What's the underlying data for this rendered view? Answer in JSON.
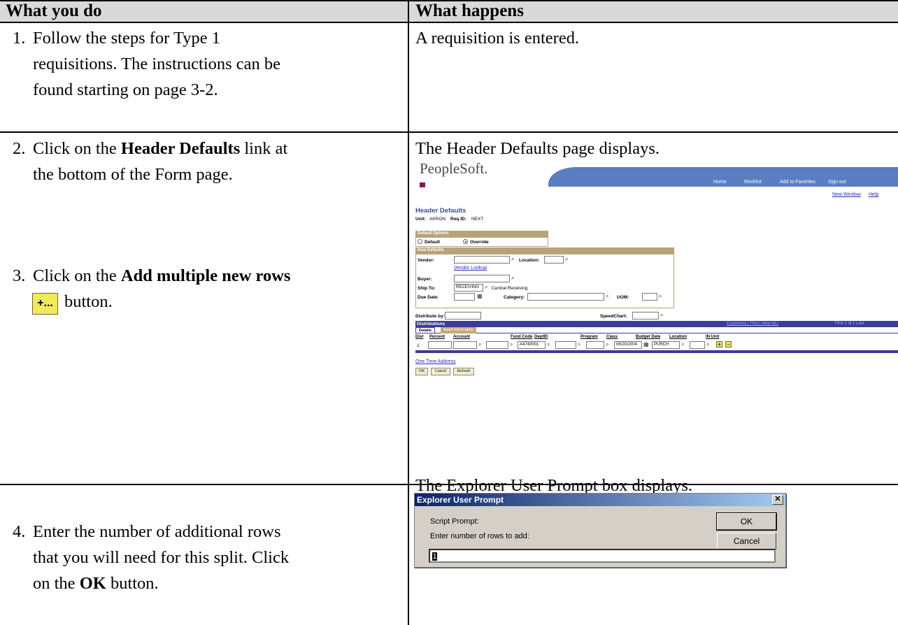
{
  "table": {
    "col_left": "What you do",
    "col_right": "What happens"
  },
  "rows": [
    {
      "num": "1.",
      "line1": "Follow the steps for Type 1",
      "line2": "requisitions.  The instructions can be",
      "line3": "found starting on page 3-2.",
      "result": "A requisition is entered."
    },
    {
      "num": "2.",
      "pre": "Click on the ",
      "bold": "Header Defaults",
      "post": " link at",
      "line2": "the bottom of the Form page.",
      "result": "The Header Defaults page displays."
    },
    {
      "num": "3.",
      "pre": "Click on the ",
      "bold": "Add multiple new rows",
      "icon_label": "+...",
      "post2": " button.",
      "result": "The Explorer User Prompt box displays."
    },
    {
      "num": "4.",
      "line1": "Enter the number of additional rows",
      "line2": "that you will need for this split.  Click",
      "pre3": "on the ",
      "bold3": "OK",
      "post3": " button."
    }
  ],
  "peoplesoft": {
    "logo": "PeopleSoft.",
    "nav": [
      "Home",
      "Worklist",
      "Add to Favorites",
      "Sign out"
    ],
    "new_window": "New Window",
    "help": "Help",
    "page_title": "Header Defaults",
    "unit_label": "Unit:",
    "unit_value": "AKRON",
    "reqid_label": "Req ID:",
    "reqid_value": "NEXT",
    "default_options": "Default Options",
    "opt_default": "Default",
    "opt_override": "Override",
    "item_defaults": "Item Defaults",
    "vendor": "Vendor:",
    "location": "Location:",
    "vendor_lookup": "Vendor Lookup",
    "buyer": "Buyer:",
    "ship_to": "Ship To:",
    "ship_to_value": "RECEIVING",
    "ship_to_desc": "Central Receiving",
    "due_date": "Due Date:",
    "category": "Category:",
    "uom": "UOM:",
    "distribute_by": "Distribute by:",
    "speedchart": "SpeedChart:",
    "distributions": "Distributions",
    "grid_nav": "Customize | Find | View All |",
    "grid_pager": "First  1 of 1  Last",
    "tab_details": "Details",
    "tab_asset": "Asset Information",
    "columns": [
      "Dist",
      "Percent",
      "Account",
      "Fund Code",
      "DeptID",
      "Program",
      "Class",
      "Budget Date",
      "Location",
      "IN Unit"
    ],
    "row_dist": "1",
    "row_dept": "A4740001",
    "row_budget_date": "08/20/2004",
    "row_location": "PURCH",
    "one_time_address": "One Time Address",
    "btn_ok": "OK",
    "btn_cancel": "Cancel",
    "btn_refresh": "Refresh"
  },
  "dialog": {
    "title": "Explorer User Prompt",
    "close": "✕",
    "script_prompt": "Script Prompt:",
    "instruction": "Enter number of rows to add:",
    "ok": "OK",
    "cancel": "Cancel",
    "value": "1"
  },
  "colors": {
    "header_bg": "#d9d9d9",
    "ps_blue": "#3b3b9a",
    "ps_tan": "#b8a27a",
    "dialog_title": "#0a246a"
  }
}
